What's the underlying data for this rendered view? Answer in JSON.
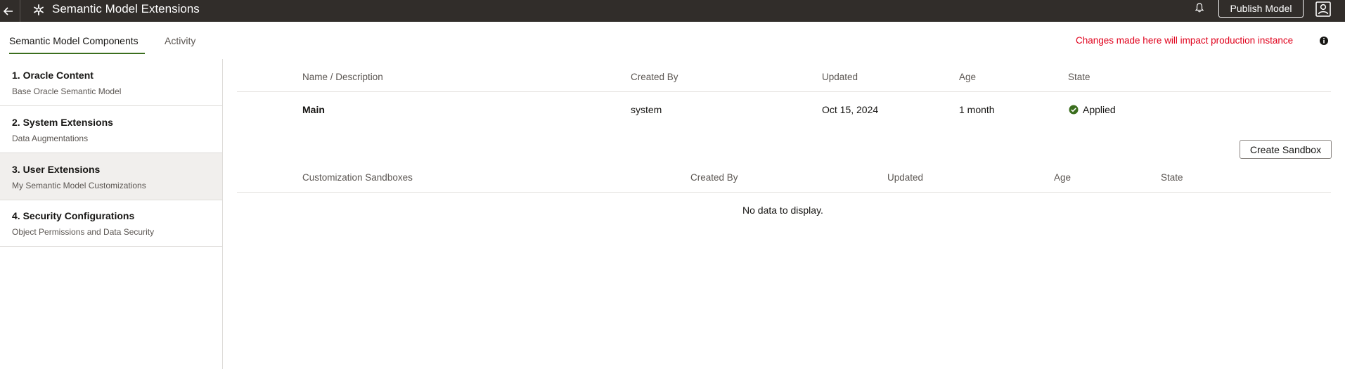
{
  "header": {
    "title": "Semantic Model Extensions",
    "publish_label": "Publish Model",
    "back_icon": "back-arrow-icon",
    "app_icon": "snowflake-icon",
    "bell_icon": "bell-icon",
    "profile_icon": "user-profile-icon"
  },
  "tabs": [
    {
      "label": "Semantic Model Components",
      "selected": true
    },
    {
      "label": "Activity",
      "selected": false
    }
  ],
  "warning": {
    "text": "Changes made here will impact production instance",
    "color": "#e0001b"
  },
  "sidebar": {
    "items": [
      {
        "title": "1. Oracle Content",
        "subtitle": "Base Oracle Semantic Model",
        "selected": false
      },
      {
        "title": "2. System Extensions",
        "subtitle": "Data Augmentations",
        "selected": false
      },
      {
        "title": "3. User Extensions",
        "subtitle": "My Semantic Model Customizations",
        "selected": true
      },
      {
        "title": "4. Security Configurations",
        "subtitle": "Object Permissions and Data Security",
        "selected": false
      }
    ]
  },
  "main_table": {
    "headers": [
      "Name / Description",
      "Created By",
      "Updated",
      "Age",
      "State"
    ],
    "rows": [
      {
        "name": "Main",
        "created_by": "system",
        "updated": "Oct 15, 2024",
        "age": "1 month",
        "state": "Applied"
      }
    ]
  },
  "sandbox": {
    "create_label": "Create Sandbox",
    "headers": [
      "Customization Sandboxes",
      "Created By",
      "Updated",
      "Age",
      "State"
    ],
    "empty_text": "No data to display."
  },
  "colors": {
    "header_bg": "#312d2a",
    "accent": "#3b6e1e",
    "applied": "#3b6e1e"
  }
}
